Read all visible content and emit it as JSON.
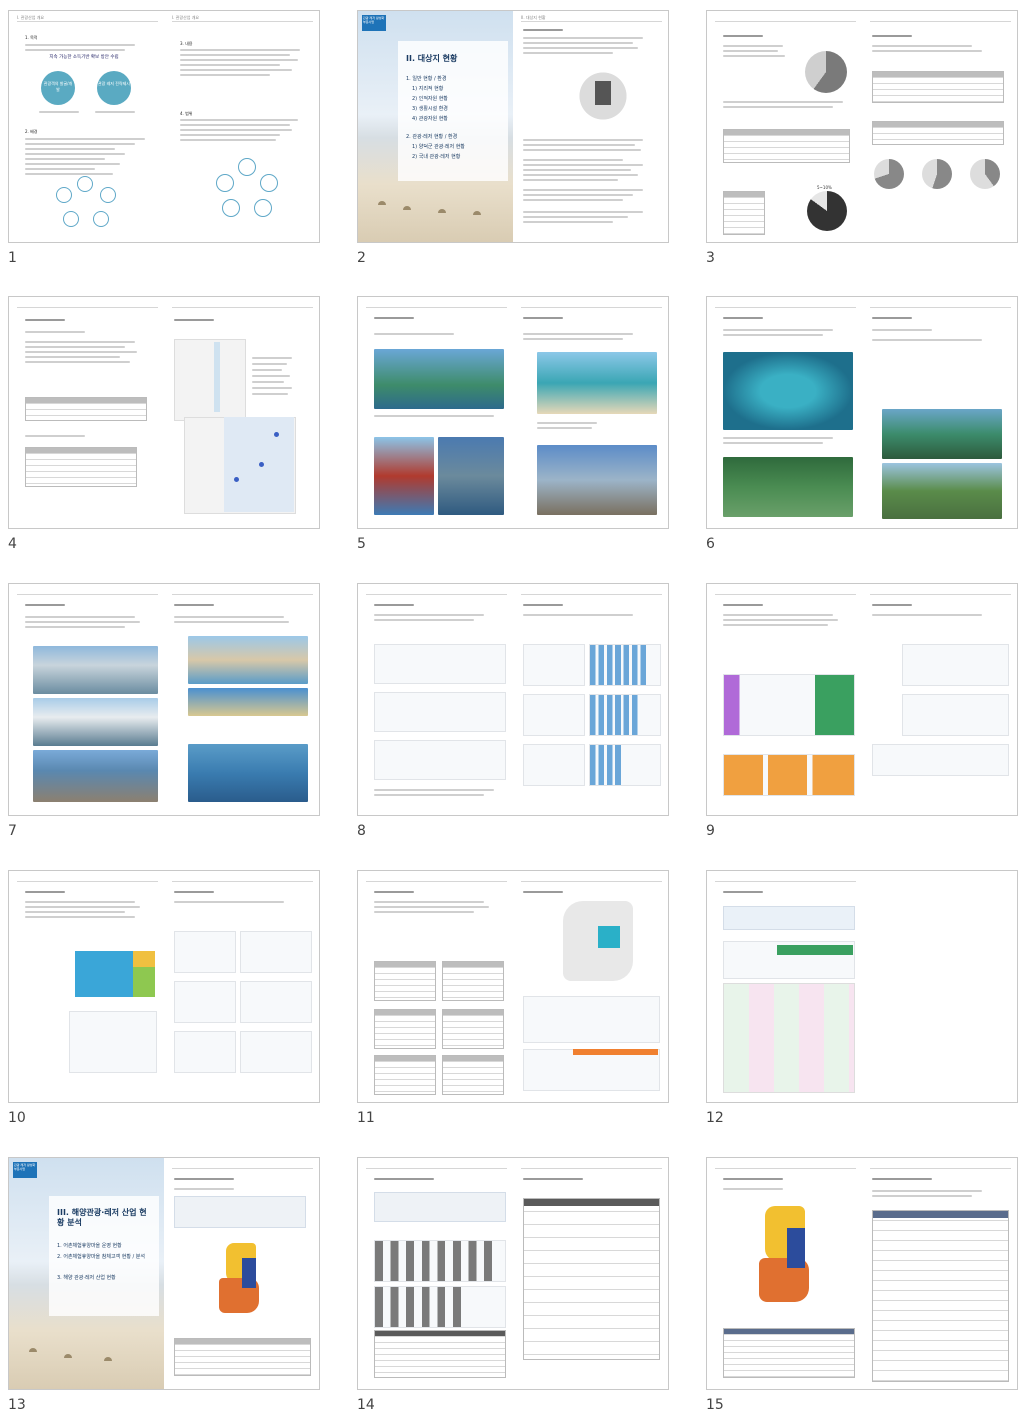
{
  "window": {
    "title": "Slide thumbnails"
  },
  "slides": [
    {
      "number": "1"
    },
    {
      "number": "2"
    },
    {
      "number": "3"
    },
    {
      "number": "4"
    },
    {
      "number": "5"
    },
    {
      "number": "6"
    },
    {
      "number": "7"
    },
    {
      "number": "8"
    },
    {
      "number": "9"
    },
    {
      "number": "10"
    },
    {
      "number": "11"
    },
    {
      "number": "12"
    },
    {
      "number": "13"
    },
    {
      "number": "14"
    },
    {
      "number": "15"
    }
  ],
  "slide1": {
    "left_header": "I. 관광산업 개요",
    "right_header": "I. 관광산업 개요",
    "sec1": "1. 목적",
    "headline": "지속 가능한 소득기반 확보 방안 수립",
    "circle1": "관광객의 발굴/개발",
    "circle2": "관광 레저 전략제시",
    "sec2": "2. 배경",
    "sec3": "3. 내용",
    "sec4": "4. 범위"
  },
  "slide2": {
    "tag": "관광 레저 활성화 부문사업",
    "title": "II. 대상지 현황",
    "item1": "1. 일반 현황 / 환경",
    "item1a": "1) 지리적 현황",
    "item1b": "2) 인적자원 현황",
    "item1c": "3) 생활시설 환경",
    "item1d": "4) 관광자원 현황",
    "item2": "2. 관광·레저 현황 / 환경",
    "item2a": "1) 양덕군 관광·레저 현황",
    "item2b": "2) 국내 관광·레저 현황",
    "right_header": "II. 대상지 현황"
  },
  "slide13": {
    "tag": "관광 레저 활성화 부문사업",
    "title": "III. 해양관광·레저 산업 현황 분석",
    "item1": "1. 어촌체험휴양마을 운영 현황",
    "item2": "2. 어촌체험휴양마을 참체고객 현황 / 분석",
    "item3": "3. 해양 관광·레저 산업 현황"
  },
  "slide3": {
    "pie_label": "8%",
    "pie_label2": "5~10%"
  },
  "colors": {
    "accent": "#1e73b8",
    "teal": "#3aa0c0",
    "cover_sky": "#cfe0ef"
  }
}
